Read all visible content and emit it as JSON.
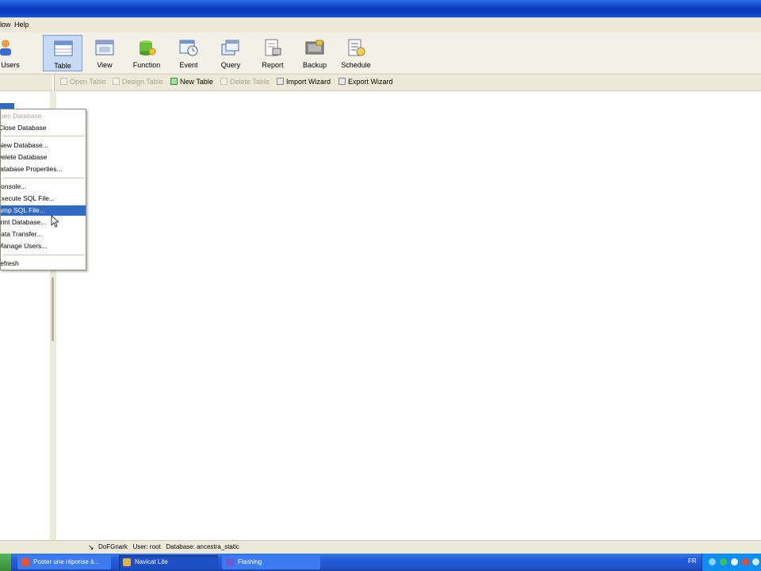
{
  "menubar": {
    "items": [
      "low",
      "Help"
    ]
  },
  "toolbar": {
    "partial_first": "Users",
    "buttons": [
      {
        "label": "Table",
        "icon": "table-icon",
        "selected": true
      },
      {
        "label": "View",
        "icon": "view-icon"
      },
      {
        "label": "Function",
        "icon": "function-icon"
      },
      {
        "label": "Event",
        "icon": "event-icon"
      },
      {
        "label": "Query",
        "icon": "query-icon"
      },
      {
        "label": "Report",
        "icon": "report-icon"
      },
      {
        "label": "Backup",
        "icon": "backup-icon"
      },
      {
        "label": "Schedule",
        "icon": "schedule-icon"
      }
    ]
  },
  "objbar": {
    "buttons": [
      {
        "label": "Open Table",
        "disabled": true
      },
      {
        "label": "Design Table",
        "disabled": true
      },
      {
        "label": "New Table",
        "disabled": false
      },
      {
        "label": "Delete Table",
        "disabled": true
      },
      {
        "label": "Import Wizard",
        "disabled": false
      },
      {
        "label": "Export Wizard",
        "disabled": false
      }
    ]
  },
  "context_menu": {
    "items": [
      {
        "label": "Open Database",
        "disabled": true
      },
      {
        "label": "Close Database"
      },
      {
        "separator": true
      },
      {
        "label": "New Database..."
      },
      {
        "label": "Delete Database"
      },
      {
        "label": "Database Properties..."
      },
      {
        "separator": true
      },
      {
        "label": "Console..."
      },
      {
        "label": "Execute SQL File..."
      },
      {
        "label": "Dump SQL File...",
        "highlighted": true
      },
      {
        "label": "Print Database..."
      },
      {
        "label": "Data Transfer..."
      },
      {
        "label": "Manage Users..."
      },
      {
        "separator": true
      },
      {
        "label": "Refresh"
      }
    ]
  },
  "statusbar": {
    "connection": "DoFGnark",
    "user": "User: root",
    "database": "Database: ancestra_static"
  },
  "taskbar": {
    "tasks": [
      {
        "label": "Poster une réponse à...",
        "active": false
      },
      {
        "label": "Navicat Lite",
        "active": true
      },
      {
        "label": "Flashing",
        "active": false
      }
    ],
    "language": "FR"
  },
  "colors": {
    "selection": "#316ac5",
    "titlebar": "#0a3fc2",
    "taskbar": "#245edb",
    "tray": "#0f8ef0"
  }
}
